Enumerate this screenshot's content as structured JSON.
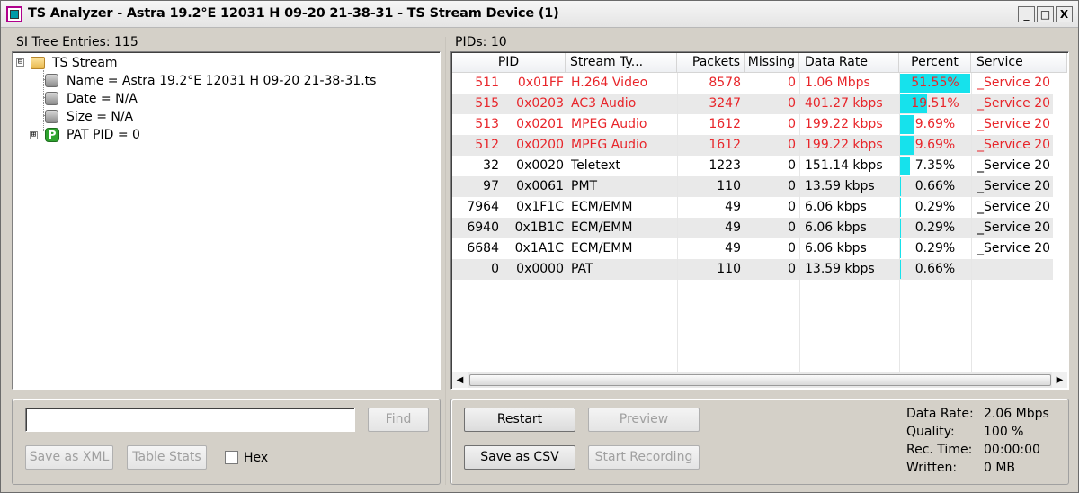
{
  "window": {
    "title": "TS Analyzer - Astra 19.2°E 12031 H 09-20 21-38-31 - TS Stream Device (1)",
    "minimize": "_",
    "maximize": "□",
    "close": "X"
  },
  "left": {
    "header": "SI Tree Entries: 115",
    "tree": [
      {
        "label": "TS Stream",
        "icon": "folder-icon",
        "expander": "⊟"
      },
      {
        "label": "Name = Astra 19.2°E 12031 H 09-20 21-38-31.ts",
        "icon": "gray-node-icon"
      },
      {
        "label": "Date = N/A",
        "icon": "gray-node-icon"
      },
      {
        "label": "Size = N/A",
        "icon": "gray-node-icon"
      },
      {
        "label": "PAT PID = 0",
        "icon": "pat-p-icon",
        "icon_text": "P",
        "expander": "⊞"
      }
    ],
    "search": {
      "value": "",
      "placeholder": ""
    },
    "find_label": "Find",
    "save_xml_label": "Save as XML",
    "table_stats_label": "Table Stats",
    "hex_label": "Hex",
    "hex_checked": false
  },
  "right": {
    "header": "PIDs: 10",
    "columns": [
      "PID",
      "",
      "Stream Ty...",
      "Packets",
      "Missing",
      "Data Rate",
      "Percent",
      "Service"
    ],
    "sort_indicator": "▽",
    "rows": [
      {
        "pid": "511",
        "hex": "0x01FF",
        "type": "H.264 Video",
        "packets": "8578",
        "missing": "0",
        "rate": "1.06 Mbps",
        "percent": "51.55%",
        "pct_value": 51.55,
        "service": "_Service 20",
        "red": true
      },
      {
        "pid": "515",
        "hex": "0x0203",
        "type": "AC3 Audio",
        "packets": "3247",
        "missing": "0",
        "rate": "401.27 kbps",
        "percent": "19.51%",
        "pct_value": 19.51,
        "service": "_Service 20",
        "red": true
      },
      {
        "pid": "513",
        "hex": "0x0201",
        "type": "MPEG Audio",
        "packets": "1612",
        "missing": "0",
        "rate": "199.22 kbps",
        "percent": "9.69%",
        "pct_value": 9.69,
        "service": "_Service 20",
        "red": true
      },
      {
        "pid": "512",
        "hex": "0x0200",
        "type": "MPEG Audio",
        "packets": "1612",
        "missing": "0",
        "rate": "199.22 kbps",
        "percent": "9.69%",
        "pct_value": 9.69,
        "service": "_Service 20",
        "red": true
      },
      {
        "pid": "32",
        "hex": "0x0020",
        "type": "Teletext",
        "packets": "1223",
        "missing": "0",
        "rate": "151.14 kbps",
        "percent": "7.35%",
        "pct_value": 7.35,
        "service": "_Service 20",
        "red": false
      },
      {
        "pid": "97",
        "hex": "0x0061",
        "type": "PMT",
        "packets": "110",
        "missing": "0",
        "rate": "13.59 kbps",
        "percent": "0.66%",
        "pct_value": 0.66,
        "service": "_Service 20",
        "red": false
      },
      {
        "pid": "7964",
        "hex": "0x1F1C",
        "type": "ECM/EMM",
        "packets": "49",
        "missing": "0",
        "rate": "6.06 kbps",
        "percent": "0.29%",
        "pct_value": 0.29,
        "service": "_Service 20",
        "red": false
      },
      {
        "pid": "6940",
        "hex": "0x1B1C",
        "type": "ECM/EMM",
        "packets": "49",
        "missing": "0",
        "rate": "6.06 kbps",
        "percent": "0.29%",
        "pct_value": 0.29,
        "service": "_Service 20",
        "red": false
      },
      {
        "pid": "6684",
        "hex": "0x1A1C",
        "type": "ECM/EMM",
        "packets": "49",
        "missing": "0",
        "rate": "6.06 kbps",
        "percent": "0.29%",
        "pct_value": 0.29,
        "service": "_Service 20",
        "red": false
      },
      {
        "pid": "0",
        "hex": "0x0000",
        "type": "PAT",
        "packets": "110",
        "missing": "0",
        "rate": "13.59 kbps",
        "percent": "0.66%",
        "pct_value": 0.66,
        "service": "",
        "red": false
      }
    ],
    "scroll_left": "◀",
    "scroll_right": "▶",
    "restart_label": "Restart",
    "preview_label": "Preview",
    "save_csv_label": "Save as CSV",
    "start_recording_label": "Start Recording",
    "stats": [
      {
        "key": "Data Rate:",
        "value": "2.06 Mbps"
      },
      {
        "key": "Quality:",
        "value": "100 %"
      },
      {
        "key": "Rec. Time:",
        "value": "00:00:00"
      },
      {
        "key": "Written:",
        "value": "0 MB"
      }
    ]
  },
  "colors": {
    "highlight_text": "#e8252a",
    "percent_bar": "#16e2ec",
    "alt_row": "#e9e9e9"
  }
}
